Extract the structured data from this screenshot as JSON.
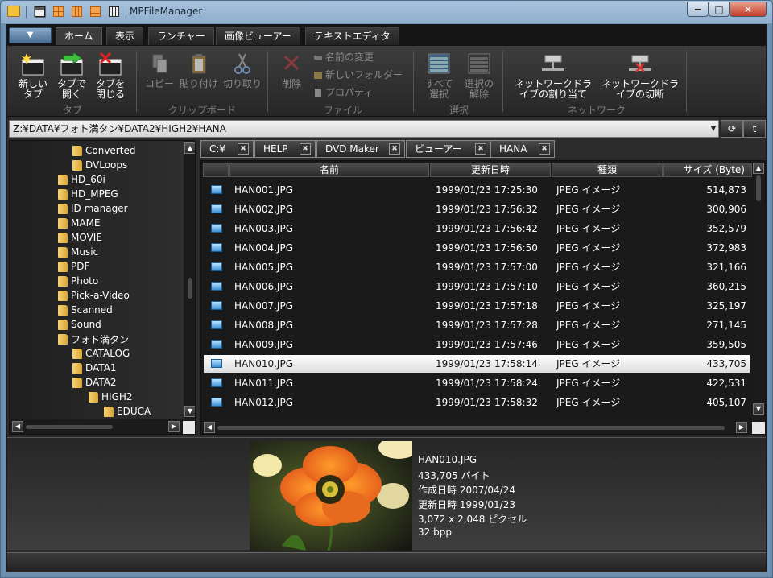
{
  "window": {
    "title": "MPFileManager",
    "min_label": "━",
    "max_label": "□",
    "close_label": "✕"
  },
  "ribbon": {
    "app_menu_label": "▼",
    "tabs": [
      "ホーム",
      "表示",
      "ランチャー",
      "画像ビューアー",
      "テキストエディタ"
    ],
    "tab_group": {
      "new_tab": [
        "新しい",
        "タブ"
      ],
      "open_tab": [
        "タブで",
        "開く"
      ],
      "close_tab": [
        "タブを",
        "閉じる"
      ],
      "label": "タブ"
    },
    "clipboard_group": {
      "copy": "コピー",
      "paste": "貼り付け",
      "cut": "切り取り",
      "label": "クリップボード"
    },
    "file_group": {
      "delete": "削除",
      "rename": "名前の変更",
      "new_folder": "新しいフォルダー",
      "properties": "プロパティ",
      "label": "ファイル"
    },
    "select_group": {
      "select_all": [
        "すべて",
        "選択"
      ],
      "deselect": [
        "選択の",
        "解除"
      ],
      "label": "選択"
    },
    "network_group": {
      "map_drive": [
        "ネットワークドラ",
        "イブの割り当て"
      ],
      "disconnect_drive": [
        "ネットワークドラ",
        "イブの切断"
      ],
      "label": "ネットワーク"
    }
  },
  "address": {
    "path": "Z:¥DATA¥フォト満タン¥DATA2¥HIGH2¥HANA",
    "dropdown_label": "▼",
    "refresh_label": "⟳",
    "up_label": "t"
  },
  "tree": {
    "items": [
      {
        "label": "Converted",
        "depth": 1
      },
      {
        "label": "DVLoops",
        "depth": 1
      },
      {
        "label": "HD_60i",
        "depth": 0
      },
      {
        "label": "HD_MPEG",
        "depth": 0
      },
      {
        "label": "ID manager",
        "depth": 0
      },
      {
        "label": "MAME",
        "depth": 0
      },
      {
        "label": "MOVIE",
        "depth": 0
      },
      {
        "label": "Music",
        "depth": 0
      },
      {
        "label": "PDF",
        "depth": 0
      },
      {
        "label": "Photo",
        "depth": 0
      },
      {
        "label": "Pick-a-Video",
        "depth": 0
      },
      {
        "label": "Scanned",
        "depth": 0
      },
      {
        "label": "Sound",
        "depth": 0
      },
      {
        "label": "フォト満タン",
        "depth": 0
      },
      {
        "label": "CATALOG",
        "depth": 1
      },
      {
        "label": "DATA1",
        "depth": 1
      },
      {
        "label": "DATA2",
        "depth": 1
      },
      {
        "label": "HIGH2",
        "depth": 2
      },
      {
        "label": "EDUCA",
        "depth": 3
      }
    ]
  },
  "folder_tabs": [
    {
      "label": "C:¥"
    },
    {
      "label": "HELP"
    },
    {
      "label": "DVD Maker"
    },
    {
      "label": "ビューアー"
    },
    {
      "label": "HANA"
    }
  ],
  "folder_tab_close": "✖",
  "file_list": {
    "columns": {
      "name": "名前",
      "modified": "更新日時",
      "type": "種類",
      "size": "サイズ (Byte)"
    },
    "selected_index": 9,
    "rows": [
      {
        "name": "HAN001.JPG",
        "modified": "1999/01/23 17:25:30",
        "type": "JPEG イメージ",
        "size": "514,873"
      },
      {
        "name": "HAN002.JPG",
        "modified": "1999/01/23 17:56:32",
        "type": "JPEG イメージ",
        "size": "300,906"
      },
      {
        "name": "HAN003.JPG",
        "modified": "1999/01/23 17:56:42",
        "type": "JPEG イメージ",
        "size": "352,579"
      },
      {
        "name": "HAN004.JPG",
        "modified": "1999/01/23 17:56:50",
        "type": "JPEG イメージ",
        "size": "372,983"
      },
      {
        "name": "HAN005.JPG",
        "modified": "1999/01/23 17:57:00",
        "type": "JPEG イメージ",
        "size": "321,166"
      },
      {
        "name": "HAN006.JPG",
        "modified": "1999/01/23 17:57:10",
        "type": "JPEG イメージ",
        "size": "360,215"
      },
      {
        "name": "HAN007.JPG",
        "modified": "1999/01/23 17:57:18",
        "type": "JPEG イメージ",
        "size": "325,197"
      },
      {
        "name": "HAN008.JPG",
        "modified": "1999/01/23 17:57:28",
        "type": "JPEG イメージ",
        "size": "271,145"
      },
      {
        "name": "HAN009.JPG",
        "modified": "1999/01/23 17:57:46",
        "type": "JPEG イメージ",
        "size": "359,505"
      },
      {
        "name": "HAN010.JPG",
        "modified": "1999/01/23 17:58:14",
        "type": "JPEG イメージ",
        "size": "433,705"
      },
      {
        "name": "HAN011.JPG",
        "modified": "1999/01/23 17:58:24",
        "type": "JPEG イメージ",
        "size": "422,531"
      },
      {
        "name": "HAN012.JPG",
        "modified": "1999/01/23 17:58:32",
        "type": "JPEG イメージ",
        "size": "405,107"
      }
    ]
  },
  "preview": {
    "lines": [
      "HAN010.JPG",
      "433,705 バイト",
      "作成日時 2007/04/24",
      "更新日時 1999/01/23",
      "3,072 x 2,048 ピクセル",
      "32 bpp"
    ]
  },
  "scroll": {
    "up": "▲",
    "down": "▼",
    "left": "◀",
    "right": "▶"
  },
  "colors": {
    "accent": "#8eaecd",
    "selected_row": "#ffffff",
    "folder": "#e9bd4d"
  }
}
